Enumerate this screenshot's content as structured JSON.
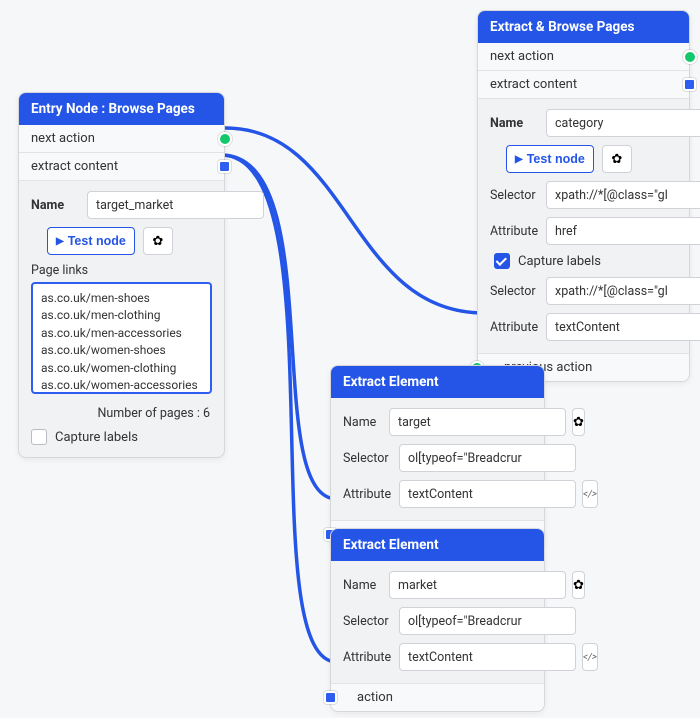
{
  "labels": {
    "next_action": "next action",
    "extract_content": "extract content",
    "previous_action": "previous action",
    "action": "action",
    "name": "Name",
    "selector": "Selector",
    "attribute": "Attribute",
    "page_links": "Page links",
    "test_node": "Test node",
    "capture_labels": "Capture labels",
    "number_of_pages_prefix": "Number of pages : "
  },
  "glyphs": {
    "play": "▶",
    "gear": "✿",
    "code": "</>"
  },
  "entry_node": {
    "title": "Entry Node : Browse Pages",
    "name_value": "target_market",
    "page_links_text": "as.co.uk/men-shoes\nas.co.uk/men-clothing\nas.co.uk/men-accessories\nas.co.uk/women-shoes\nas.co.uk/women-clothing\nas.co.uk/women-accessories",
    "page_count": 6,
    "capture_labels_checked": false
  },
  "extract_browse": {
    "title": "Extract & Browse Pages",
    "name_value": "category",
    "selector1": "xpath://*[@class=\"gl",
    "attribute1": "href",
    "capture_labels_checked": true,
    "selector2": "xpath://*[@class=\"gl",
    "attribute2": "textContent"
  },
  "extract1": {
    "title": "Extract Element",
    "name_value": "target",
    "selector": "ol[typeof=\"Breadcrur",
    "attribute": "textContent"
  },
  "extract2": {
    "title": "Extract Element",
    "name_value": "market",
    "selector": "ol[typeof=\"Breadcrur",
    "attribute": "textContent"
  }
}
